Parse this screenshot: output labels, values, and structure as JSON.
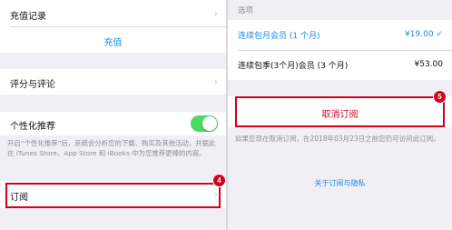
{
  "left": {
    "recharge_record": "充值记录",
    "recharge_link": "充值",
    "ratings_reviews": "评分与评论",
    "personalized": "个性化推荐",
    "personalized_desc": "开启“个性化推荐”后，系统会分析您的下载、购买及其他活动，并据此在 iTunes Store、App Store 和 iBooks 中为您推荐更棒的内容。",
    "subscriptions": "订阅",
    "personalized_toggle_on": true,
    "badge": "4"
  },
  "right": {
    "options_header": "选项",
    "plans": [
      {
        "name": "连续包月会员 (1 个月)",
        "price": "¥19.00",
        "selected": true,
        "check": "✓"
      },
      {
        "name": "连续包季(3个月)会员 (3 个月)",
        "price": "¥53.00",
        "selected": false,
        "check": ""
      }
    ],
    "cancel_button": "取消订阅",
    "badge": "5",
    "cancel_note": "如果您现在取消订阅，在2018年03月23日之前您仍可访问此订阅。",
    "about_link": "关于订阅与隐私"
  },
  "colors": {
    "accent": "#1a8ae6",
    "highlight": "#d0021b",
    "toggle_on": "#4cd964"
  }
}
